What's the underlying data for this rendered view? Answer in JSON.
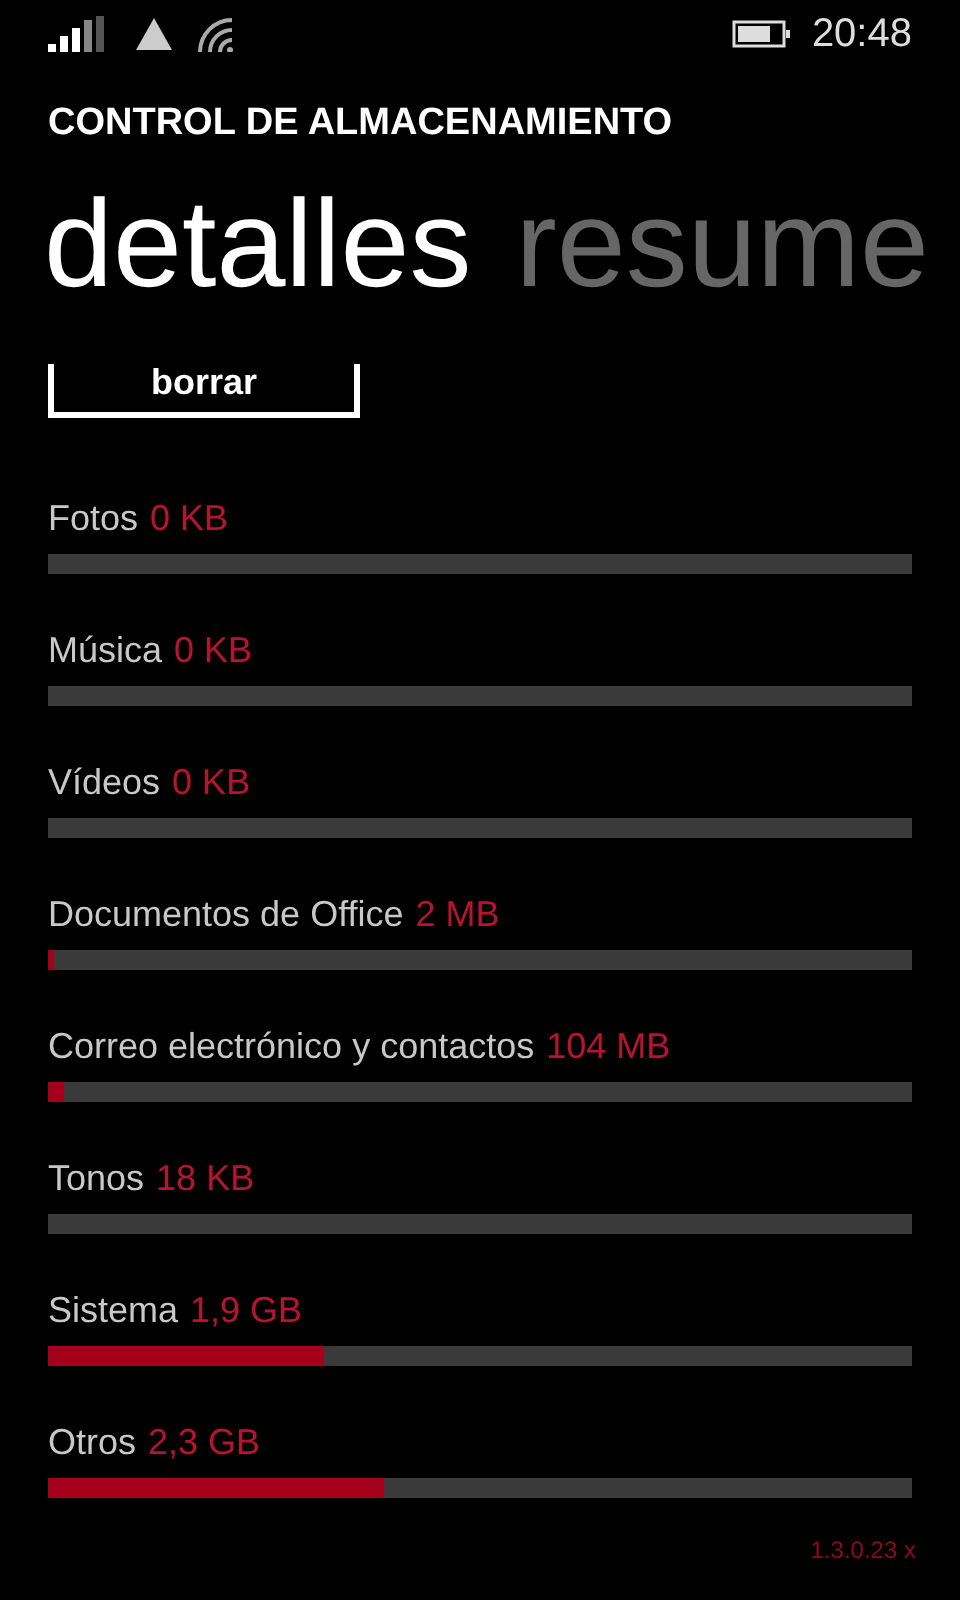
{
  "status_bar": {
    "time": "20:48"
  },
  "app_title": "CONTROL DE ALMACENAMIENTO",
  "pivot": [
    {
      "label": "detalles",
      "selected": true
    },
    {
      "label": "resume",
      "selected": false
    }
  ],
  "clear_button": "borrar",
  "categories": [
    {
      "name": "Fotos",
      "size": "0 KB"
    },
    {
      "name": "Música",
      "size": "0 KB"
    },
    {
      "name": "Vídeos",
      "size": "0 KB"
    },
    {
      "name": "Documentos de Office",
      "size": "2 MB",
      "level": 0.007
    },
    {
      "name": "Correo electrónico y contactos",
      "size": "104 MB",
      "level": 0.018
    },
    {
      "name": "Tonos",
      "size": "18 KB"
    },
    {
      "name": "Sistema",
      "size": "1,9 GB",
      "level": 0.32
    },
    {
      "name": "Otros",
      "size": "2,3 GB",
      "level": 0.39
    }
  ],
  "version": "1.3.0.23 x"
}
